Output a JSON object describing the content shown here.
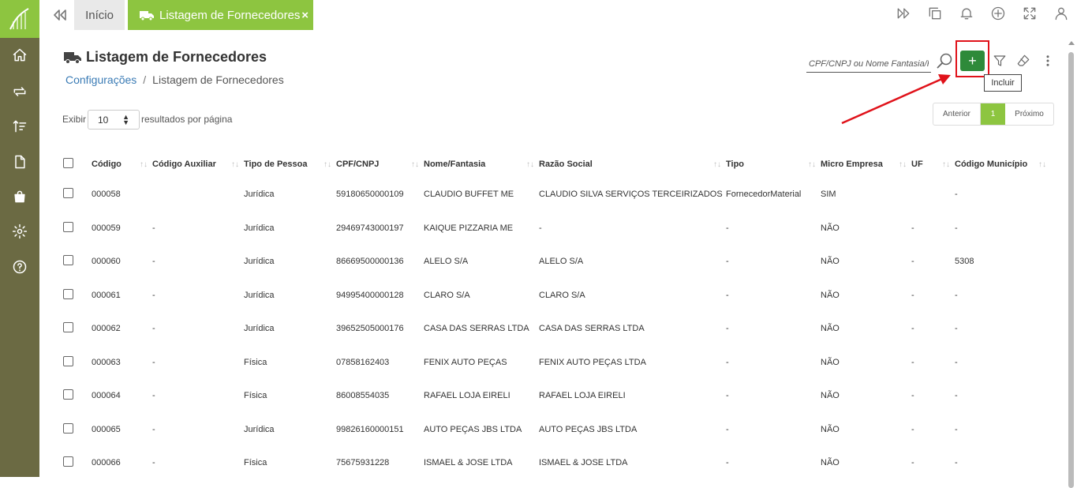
{
  "sidebar": {
    "items": [
      {
        "icon": "home-icon"
      },
      {
        "icon": "transfer-icon"
      },
      {
        "icon": "sort-icon"
      },
      {
        "icon": "document-icon"
      },
      {
        "icon": "bag-icon"
      },
      {
        "icon": "gear-icon"
      },
      {
        "icon": "help-icon"
      }
    ]
  },
  "topbar": {
    "home_tab": "Início",
    "active_tab": "Listagem de Fornecedores",
    "close_symbol": "×"
  },
  "page": {
    "title": "Listagem de Fornecedores",
    "breadcrumb": {
      "parent": "Configurações",
      "separator": "/",
      "current": "Listagem de Fornecedores"
    }
  },
  "toolbar": {
    "search_placeholder": "CPF/CNPJ ou Nome Fantasia/Razão Social",
    "add_symbol": "+",
    "tooltip": "Incluir"
  },
  "list_controls": {
    "show_label": "Exibir",
    "page_size": "10",
    "per_page_label": "resultados por página"
  },
  "pagination": {
    "prev": "Anterior",
    "current": "1",
    "next": "Próximo"
  },
  "table": {
    "headers": [
      "Código",
      "Código Auxiliar",
      "Tipo de Pessoa",
      "CPF/CNPJ",
      "Nome/Fantasia",
      "Razão Social",
      "Tipo",
      "Micro Empresa",
      "UF",
      "Código Município"
    ],
    "sort_glyph": "↑↓",
    "rows": [
      [
        "000058",
        "",
        "Jurídica",
        "59180650000109",
        "CLAUDIO BUFFET ME",
        "CLAUDIO SILVA SERVIÇOS TERCEIRIZADOS",
        "FornecedorMaterial",
        "SIM",
        "",
        "-"
      ],
      [
        "000059",
        "-",
        "Jurídica",
        "29469743000197",
        "KAIQUE PIZZARIA ME",
        "-",
        "-",
        "NÃO",
        "-",
        "-"
      ],
      [
        "000060",
        "-",
        "Jurídica",
        "86669500000136",
        "ALELO S/A",
        "ALELO S/A",
        "-",
        "NÃO",
        "-",
        "5308"
      ],
      [
        "000061",
        "-",
        "Jurídica",
        "94995400000128",
        "CLARO S/A",
        "CLARO S/A",
        "-",
        "NÃO",
        "-",
        "-"
      ],
      [
        "000062",
        "-",
        "Jurídica",
        "39652505000176",
        "CASA DAS SERRAS LTDA",
        "CASA DAS SERRAS LTDA",
        "-",
        "NÃO",
        "-",
        "-"
      ],
      [
        "000063",
        "-",
        "Física",
        "07858162403",
        "FENIX AUTO PEÇAS",
        "FENIX AUTO PEÇAS LTDA",
        "-",
        "NÃO",
        "-",
        "-"
      ],
      [
        "000064",
        "-",
        "Física",
        "86008554035",
        "RAFAEL LOJA EIRELI",
        "RAFAEL LOJA EIRELI",
        "-",
        "NÃO",
        "-",
        "-"
      ],
      [
        "000065",
        "-",
        "Jurídica",
        "99826160000151",
        "AUTO PEÇAS JBS LTDA",
        "AUTO PEÇAS JBS LTDA",
        "-",
        "NÃO",
        "-",
        "-"
      ],
      [
        "000066",
        "-",
        "Física",
        "75675931228",
        "ISMAEL & JOSE LTDA",
        "ISMAEL & JOSE LTDA",
        "-",
        "NÃO",
        "-",
        "-"
      ]
    ]
  },
  "colors": {
    "brand_green": "#8dc540",
    "sidebar_olive": "#6b6a43",
    "add_button": "#2e8a3a",
    "annotation_red": "#e0121a",
    "link_blue": "#3a7bb5"
  }
}
